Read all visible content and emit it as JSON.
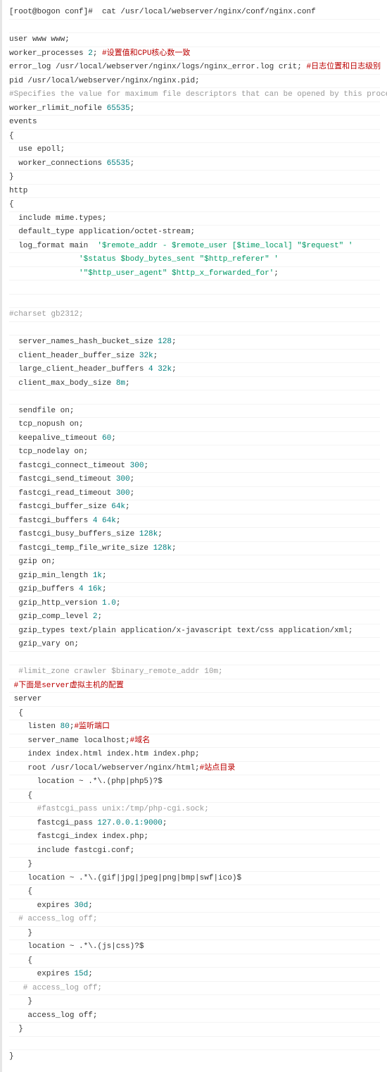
{
  "lines": [
    {
      "segments": [
        {
          "t": "[root@bogon conf]#  cat /usr/local/webserver/nginx/conf/nginx.conf",
          "c": "kw"
        }
      ]
    },
    {
      "segments": [
        {
          "t": " ",
          "c": "kw"
        }
      ]
    },
    {
      "segments": [
        {
          "t": "user www www;",
          "c": "kw"
        }
      ]
    },
    {
      "segments": [
        {
          "t": "worker_processes ",
          "c": "kw"
        },
        {
          "t": "2",
          "c": "num"
        },
        {
          "t": "; ",
          "c": "kw"
        },
        {
          "t": "#设置值和CPU核心数一致",
          "c": "red"
        }
      ]
    },
    {
      "segments": [
        {
          "t": "error_log /usr/local/webserver/nginx/logs/nginx_error.log crit; ",
          "c": "kw"
        },
        {
          "t": "#日志位置和日志级别",
          "c": "red"
        }
      ]
    },
    {
      "segments": [
        {
          "t": "pid /usr/local/webserver/nginx/nginx.pid;",
          "c": "kw"
        }
      ]
    },
    {
      "segments": [
        {
          "t": "#Specifies the value for maximum file descriptors that can be opened by this process.",
          "c": "cmt"
        }
      ]
    },
    {
      "segments": [
        {
          "t": "worker_rlimit_nofile ",
          "c": "kw"
        },
        {
          "t": "65535",
          "c": "num"
        },
        {
          "t": ";",
          "c": "kw"
        }
      ]
    },
    {
      "segments": [
        {
          "t": "events",
          "c": "kw"
        }
      ]
    },
    {
      "segments": [
        {
          "t": "{",
          "c": "kw"
        }
      ]
    },
    {
      "segments": [
        {
          "t": "  use epoll;",
          "c": "kw"
        }
      ]
    },
    {
      "segments": [
        {
          "t": "  worker_connections ",
          "c": "kw"
        },
        {
          "t": "65535",
          "c": "num"
        },
        {
          "t": ";",
          "c": "kw"
        }
      ]
    },
    {
      "segments": [
        {
          "t": "}",
          "c": "kw"
        }
      ]
    },
    {
      "segments": [
        {
          "t": "http",
          "c": "kw"
        }
      ]
    },
    {
      "segments": [
        {
          "t": "{",
          "c": "kw"
        }
      ]
    },
    {
      "segments": [
        {
          "t": "  include mime.types;",
          "c": "kw"
        }
      ]
    },
    {
      "segments": [
        {
          "t": "  default_type application/octet-stream;",
          "c": "kw"
        }
      ]
    },
    {
      "segments": [
        {
          "t": "  log_format main  ",
          "c": "kw"
        },
        {
          "t": "'$remote_addr - $remote_user [$time_local] \"$request\" '",
          "c": "str"
        }
      ]
    },
    {
      "segments": [
        {
          "t": "               ",
          "c": "kw"
        },
        {
          "t": "'$status $body_bytes_sent \"$http_referer\" '",
          "c": "str"
        }
      ]
    },
    {
      "segments": [
        {
          "t": "               ",
          "c": "kw"
        },
        {
          "t": "'\"$http_user_agent\" $http_x_forwarded_for'",
          "c": "str"
        },
        {
          "t": ";",
          "c": "kw"
        }
      ]
    },
    {
      "segments": [
        {
          "t": "  ",
          "c": "kw"
        }
      ]
    },
    {
      "segments": [
        {
          "t": " ",
          "c": "kw"
        }
      ]
    },
    {
      "segments": [
        {
          "t": "#charset gb2312;",
          "c": "cmt"
        }
      ]
    },
    {
      "segments": [
        {
          "t": "     ",
          "c": "kw"
        }
      ]
    },
    {
      "segments": [
        {
          "t": "  server_names_hash_bucket_size ",
          "c": "kw"
        },
        {
          "t": "128",
          "c": "num"
        },
        {
          "t": ";",
          "c": "kw"
        }
      ]
    },
    {
      "segments": [
        {
          "t": "  client_header_buffer_size ",
          "c": "kw"
        },
        {
          "t": "32k",
          "c": "num"
        },
        {
          "t": ";",
          "c": "kw"
        }
      ]
    },
    {
      "segments": [
        {
          "t": "  large_client_header_buffers ",
          "c": "kw"
        },
        {
          "t": "4 32k",
          "c": "num"
        },
        {
          "t": ";",
          "c": "kw"
        }
      ]
    },
    {
      "segments": [
        {
          "t": "  client_max_body_size ",
          "c": "kw"
        },
        {
          "t": "8m",
          "c": "num"
        },
        {
          "t": ";",
          "c": "kw"
        }
      ]
    },
    {
      "segments": [
        {
          "t": "     ",
          "c": "kw"
        }
      ]
    },
    {
      "segments": [
        {
          "t": "  sendfile on;",
          "c": "kw"
        }
      ]
    },
    {
      "segments": [
        {
          "t": "  tcp_nopush on;",
          "c": "kw"
        }
      ]
    },
    {
      "segments": [
        {
          "t": "  keepalive_timeout ",
          "c": "kw"
        },
        {
          "t": "60",
          "c": "num"
        },
        {
          "t": ";",
          "c": "kw"
        }
      ]
    },
    {
      "segments": [
        {
          "t": "  tcp_nodelay on;",
          "c": "kw"
        }
      ]
    },
    {
      "segments": [
        {
          "t": "  fastcgi_connect_timeout ",
          "c": "kw"
        },
        {
          "t": "300",
          "c": "num"
        },
        {
          "t": ";",
          "c": "kw"
        }
      ]
    },
    {
      "segments": [
        {
          "t": "  fastcgi_send_timeout ",
          "c": "kw"
        },
        {
          "t": "300",
          "c": "num"
        },
        {
          "t": ";",
          "c": "kw"
        }
      ]
    },
    {
      "segments": [
        {
          "t": "  fastcgi_read_timeout ",
          "c": "kw"
        },
        {
          "t": "300",
          "c": "num"
        },
        {
          "t": ";",
          "c": "kw"
        }
      ]
    },
    {
      "segments": [
        {
          "t": "  fastcgi_buffer_size ",
          "c": "kw"
        },
        {
          "t": "64k",
          "c": "num"
        },
        {
          "t": ";",
          "c": "kw"
        }
      ]
    },
    {
      "segments": [
        {
          "t": "  fastcgi_buffers ",
          "c": "kw"
        },
        {
          "t": "4 64k",
          "c": "num"
        },
        {
          "t": ";",
          "c": "kw"
        }
      ]
    },
    {
      "segments": [
        {
          "t": "  fastcgi_busy_buffers_size ",
          "c": "kw"
        },
        {
          "t": "128k",
          "c": "num"
        },
        {
          "t": ";",
          "c": "kw"
        }
      ]
    },
    {
      "segments": [
        {
          "t": "  fastcgi_temp_file_write_size ",
          "c": "kw"
        },
        {
          "t": "128k",
          "c": "num"
        },
        {
          "t": ";",
          "c": "kw"
        }
      ]
    },
    {
      "segments": [
        {
          "t": "  gzip on; ",
          "c": "kw"
        }
      ]
    },
    {
      "segments": [
        {
          "t": "  gzip_min_length ",
          "c": "kw"
        },
        {
          "t": "1k",
          "c": "num"
        },
        {
          "t": ";",
          "c": "kw"
        }
      ]
    },
    {
      "segments": [
        {
          "t": "  gzip_buffers ",
          "c": "kw"
        },
        {
          "t": "4 16k",
          "c": "num"
        },
        {
          "t": ";",
          "c": "kw"
        }
      ]
    },
    {
      "segments": [
        {
          "t": "  gzip_http_version ",
          "c": "kw"
        },
        {
          "t": "1.0",
          "c": "num"
        },
        {
          "t": ";",
          "c": "kw"
        }
      ]
    },
    {
      "segments": [
        {
          "t": "  gzip_comp_level ",
          "c": "kw"
        },
        {
          "t": "2",
          "c": "num"
        },
        {
          "t": ";",
          "c": "kw"
        }
      ]
    },
    {
      "segments": [
        {
          "t": "  gzip_types text/plain application/x-javascript text/css application/xml;",
          "c": "kw"
        }
      ]
    },
    {
      "segments": [
        {
          "t": "  gzip_vary on;",
          "c": "kw"
        }
      ]
    },
    {
      "segments": [
        {
          "t": " ",
          "c": "kw"
        }
      ]
    },
    {
      "segments": [
        {
          "t": "  #limit_zone crawler $binary_remote_addr 10m;",
          "c": "cmt"
        }
      ]
    },
    {
      "segments": [
        {
          "t": " ",
          "c": "kw"
        },
        {
          "t": "#下面是server虚拟主机的配置",
          "c": "red"
        }
      ]
    },
    {
      "segments": [
        {
          "t": " server",
          "c": "kw"
        }
      ]
    },
    {
      "segments": [
        {
          "t": "  {",
          "c": "kw"
        }
      ]
    },
    {
      "segments": [
        {
          "t": "    listen ",
          "c": "kw"
        },
        {
          "t": "80",
          "c": "num"
        },
        {
          "t": ";",
          "c": "kw"
        },
        {
          "t": "#监听端口",
          "c": "red"
        }
      ]
    },
    {
      "segments": [
        {
          "t": "    server_name localhost;",
          "c": "kw"
        },
        {
          "t": "#域名",
          "c": "red"
        }
      ]
    },
    {
      "segments": [
        {
          "t": "    index index.html index.htm index.php;",
          "c": "kw"
        }
      ]
    },
    {
      "segments": [
        {
          "t": "    root /usr/local/webserver/nginx/html;",
          "c": "kw"
        },
        {
          "t": "#站点目录",
          "c": "red"
        }
      ]
    },
    {
      "segments": [
        {
          "t": "      location ~ .*\\.(php|php5)?$",
          "c": "kw"
        }
      ]
    },
    {
      "segments": [
        {
          "t": "    {",
          "c": "kw"
        }
      ]
    },
    {
      "segments": [
        {
          "t": "      #fastcgi_pass unix:/tmp/php-cgi.sock;",
          "c": "cmt"
        }
      ]
    },
    {
      "segments": [
        {
          "t": "      fastcgi_pass ",
          "c": "kw"
        },
        {
          "t": "127.0.0.1:9000",
          "c": "num"
        },
        {
          "t": ";",
          "c": "kw"
        }
      ]
    },
    {
      "segments": [
        {
          "t": "      fastcgi_index index.php;",
          "c": "kw"
        }
      ]
    },
    {
      "segments": [
        {
          "t": "      include fastcgi.conf;",
          "c": "kw"
        }
      ]
    },
    {
      "segments": [
        {
          "t": "    }",
          "c": "kw"
        }
      ]
    },
    {
      "segments": [
        {
          "t": "    location ~ .*\\.(gif|jpg|jpeg|png|bmp|swf|ico)$",
          "c": "kw"
        }
      ]
    },
    {
      "segments": [
        {
          "t": "    {",
          "c": "kw"
        }
      ]
    },
    {
      "segments": [
        {
          "t": "      expires ",
          "c": "kw"
        },
        {
          "t": "30d",
          "c": "num"
        },
        {
          "t": ";",
          "c": "kw"
        }
      ]
    },
    {
      "segments": [
        {
          "t": "  # access_log off;",
          "c": "cmt"
        }
      ]
    },
    {
      "segments": [
        {
          "t": "    }",
          "c": "kw"
        }
      ]
    },
    {
      "segments": [
        {
          "t": "    location ~ .*\\.(js|css)?$",
          "c": "kw"
        }
      ]
    },
    {
      "segments": [
        {
          "t": "    {",
          "c": "kw"
        }
      ]
    },
    {
      "segments": [
        {
          "t": "      expires ",
          "c": "kw"
        },
        {
          "t": "15d",
          "c": "num"
        },
        {
          "t": ";",
          "c": "kw"
        }
      ]
    },
    {
      "segments": [
        {
          "t": "   # access_log off;",
          "c": "cmt"
        }
      ]
    },
    {
      "segments": [
        {
          "t": "    }",
          "c": "kw"
        }
      ]
    },
    {
      "segments": [
        {
          "t": "    access_log off;",
          "c": "kw"
        }
      ]
    },
    {
      "segments": [
        {
          "t": "  }",
          "c": "kw"
        }
      ]
    },
    {
      "segments": [
        {
          "t": " ",
          "c": "kw"
        }
      ]
    },
    {
      "segments": [
        {
          "t": "}",
          "c": "kw"
        }
      ]
    }
  ]
}
